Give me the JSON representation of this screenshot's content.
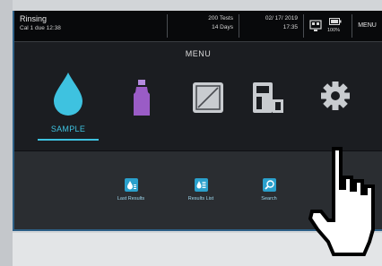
{
  "status_bar": {
    "title": "Rinsing",
    "subtitle": "Cal 1 due 12:38",
    "tests": "200 Tests",
    "days": "14 Days",
    "date": "02/ 17/ 2019",
    "time": "17:35",
    "battery": "100%",
    "menu_label": "MENU"
  },
  "menu": {
    "title": "MENU",
    "items": [
      {
        "label": "SAMPLE",
        "icon": "droplet-icon",
        "selected": true
      },
      {
        "icon": "reagent-vial-icon"
      },
      {
        "icon": "calibration-chart-icon"
      },
      {
        "icon": "analyzer-device-icon"
      },
      {
        "icon": "gear-icon"
      }
    ]
  },
  "sample_submenu": [
    {
      "label": "Last Results",
      "icon": "last-results-icon"
    },
    {
      "label": "Results List",
      "icon": "results-list-icon"
    },
    {
      "label": "Search",
      "icon": "search-icon"
    }
  ],
  "colors": {
    "accent": "#3ec2e0",
    "vial": "#9a5cc6",
    "icon_gray": "#c9ccd0"
  }
}
